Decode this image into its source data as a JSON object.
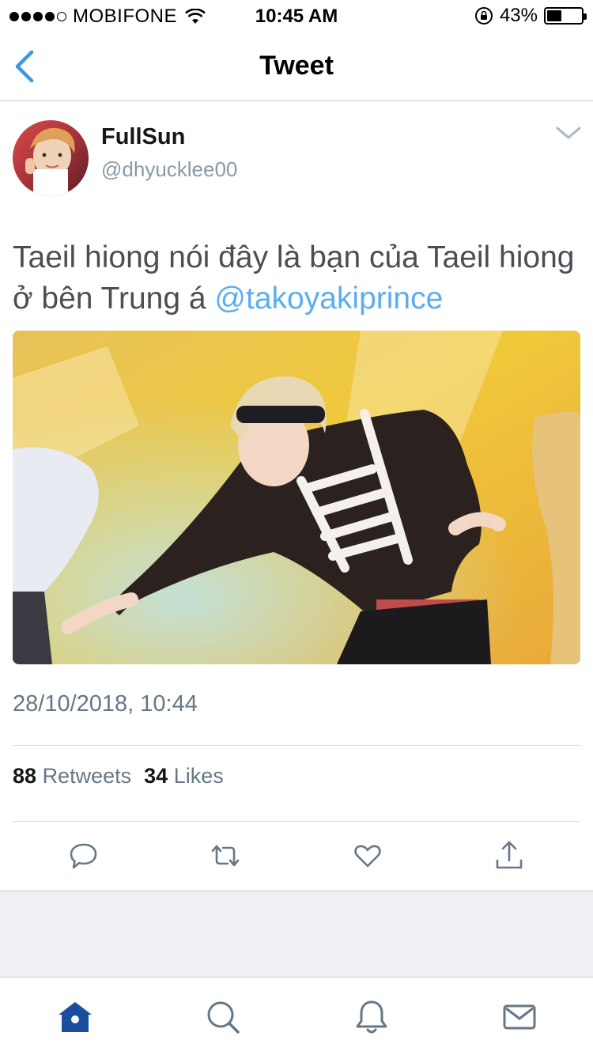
{
  "status_bar": {
    "carrier": "MOBIFONE",
    "time": "10:45 AM",
    "battery": "43%",
    "battery_level": 0.43,
    "signal_bars": 4
  },
  "nav": {
    "title": "Tweet",
    "back_icon": "chevron-left-icon"
  },
  "tweet": {
    "author_name": "FullSun",
    "author_handle": "@dhyucklee00",
    "text": "Taeil hiong nói đây là bạn của Taeil hiong ở bên Trung á ",
    "mention": "@takoyakiprince",
    "timestamp": "28/10/2018, 10:44",
    "retweets_count": "88",
    "retweets_label": "Retweets",
    "likes_count": "34",
    "likes_label": "Likes"
  },
  "actions": [
    "reply-icon",
    "retweet-icon",
    "like-icon",
    "share-icon"
  ],
  "tabs": [
    "home-icon",
    "search-icon",
    "notifications-icon",
    "messages-icon"
  ],
  "colors": {
    "accent": "#1da1f2",
    "mention": "#5aaef0",
    "secondary_text": "#657786",
    "home_tab": "#1b4d9e",
    "tab_inactive": "#657786"
  }
}
